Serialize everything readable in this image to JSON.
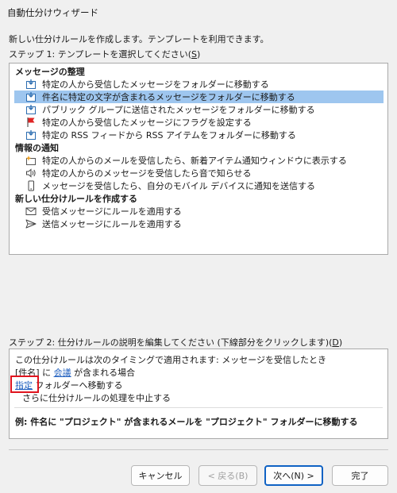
{
  "window": {
    "title": "自動仕分けウィザード"
  },
  "intro": "新しい仕分けルールを作成します。テンプレートを利用できます。",
  "step1": {
    "label_prefix": "ステップ 1: テンプレートを選択してください(",
    "label_key": "S",
    "label_suffix": ")"
  },
  "templates": {
    "groups": [
      {
        "header": "メッセージの整理",
        "items": [
          {
            "label": "特定の人から受信したメッセージをフォルダーに移動する",
            "icon": "move-to-folder-icon"
          },
          {
            "label": "件名に特定の文字が含まれるメッセージをフォルダーに移動する",
            "icon": "move-to-folder-icon",
            "selected": true
          },
          {
            "label": "パブリック グループに送信されたメッセージをフォルダーに移動する",
            "icon": "move-to-folder-icon"
          },
          {
            "label": "特定の人から受信したメッセージにフラグを設定する",
            "icon": "flag-icon"
          },
          {
            "label": "特定の RSS フィードから RSS アイテムをフォルダーに移動する",
            "icon": "move-to-folder-icon"
          }
        ]
      },
      {
        "header": "情報の通知",
        "items": [
          {
            "label": "特定の人からのメールを受信したら、新着アイテム通知ウィンドウに表示する",
            "icon": "new-item-alert-icon"
          },
          {
            "label": "特定の人からのメッセージを受信したら音で知らせる",
            "icon": "speaker-icon"
          },
          {
            "label": "メッセージを受信したら、自分のモバイル デバイスに通知を送信する",
            "icon": "mobile-device-icon"
          }
        ]
      },
      {
        "header": "新しい仕分けルールを作成する",
        "items": [
          {
            "label": "受信メッセージにルールを適用する",
            "icon": "envelope-icon"
          },
          {
            "label": "送信メッセージにルールを適用する",
            "icon": "send-icon"
          }
        ]
      }
    ]
  },
  "step2": {
    "label_prefix": "ステップ 2: 仕分けルールの説明を編集してください (下線部分をクリックします)(",
    "label_key": "D",
    "label_suffix": ")"
  },
  "description": {
    "line1": "この仕分けルールは次のタイミングで適用されます: メッセージを受信したとき",
    "line2_field": "[件名]",
    "line2_mid": " に ",
    "line2_link": "会議",
    "line2_end": " が含まれる場合",
    "line3_link": "指定",
    "line3_end": " フォルダーへ移動する",
    "line4": "さらに仕分けルールの処理を中止する",
    "example": "例: 件名に \"プロジェクト\" が含まれるメールを \"プロジェクト\" フォルダーに移動する"
  },
  "buttons": {
    "cancel": "キャンセル",
    "back": "< 戻る(B)",
    "next": "次へ(N) >",
    "finish": "完了"
  },
  "colors": {
    "selection": "#9ec6ef",
    "link": "#1f5fbf",
    "highlight": "#e0141e",
    "default_button_border": "#0f62c4"
  }
}
